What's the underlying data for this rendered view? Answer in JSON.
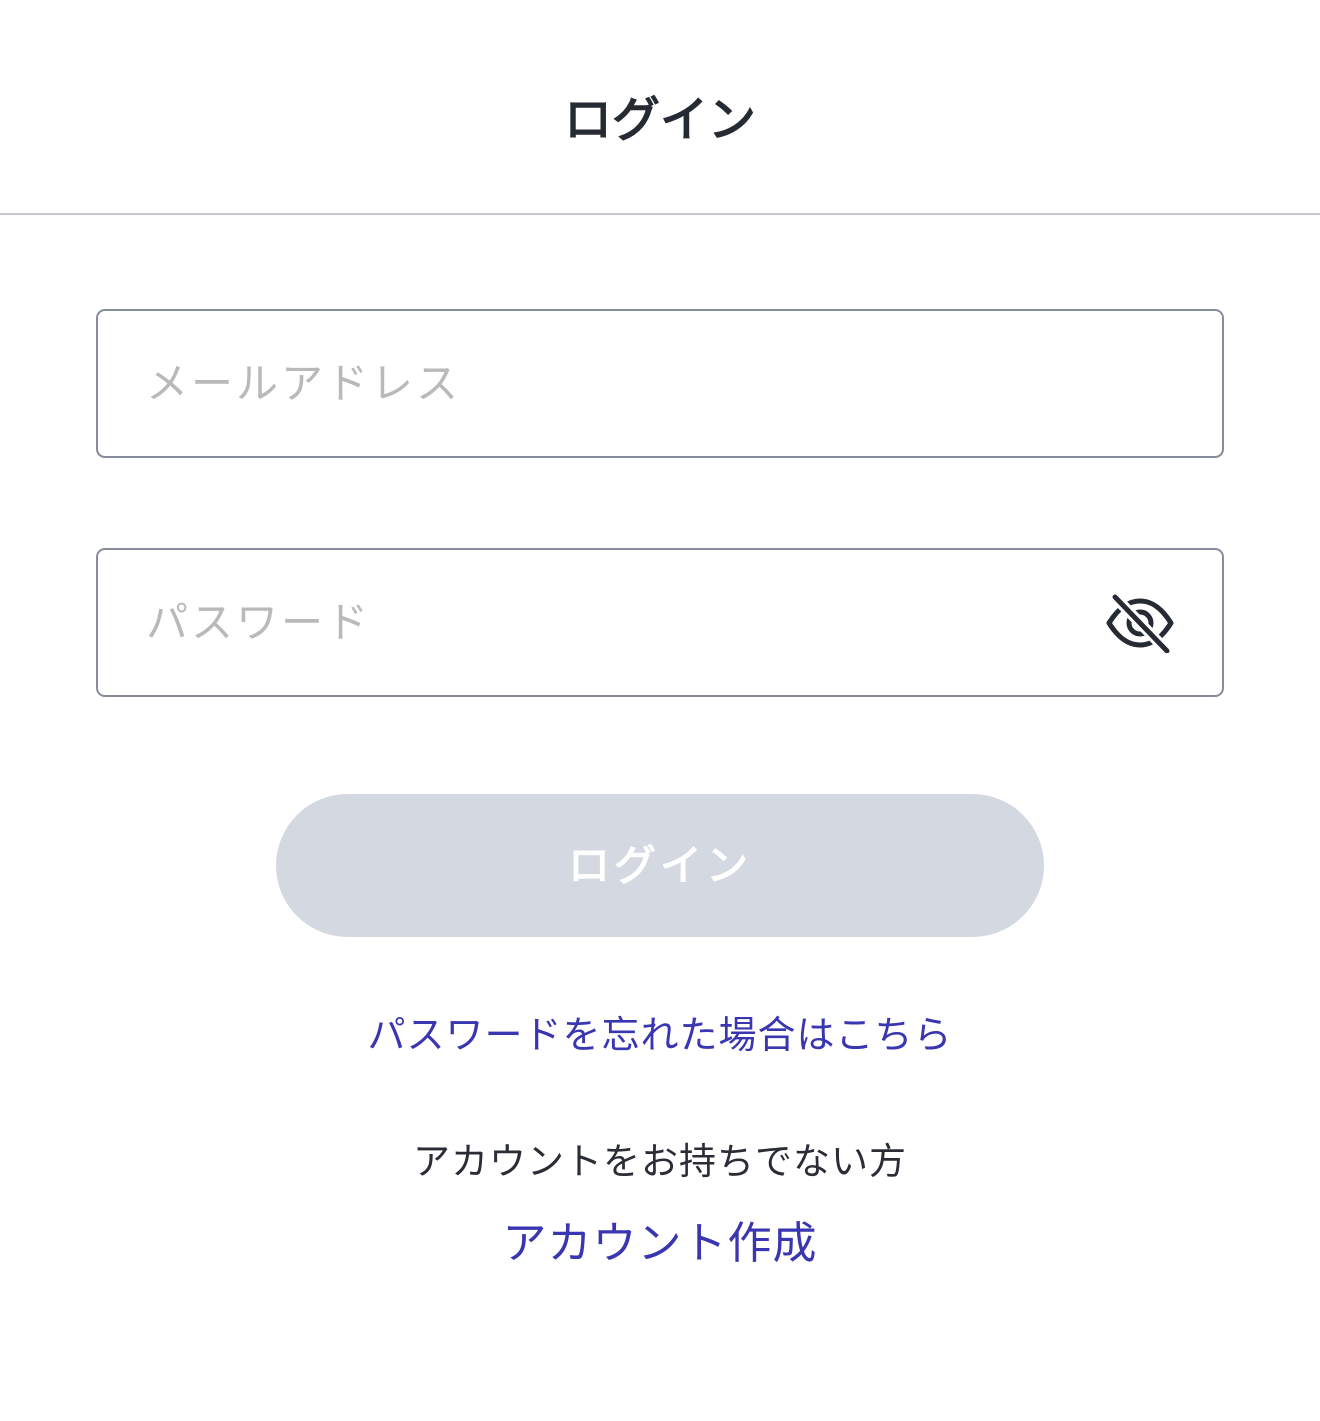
{
  "header": {
    "title": "ログイン"
  },
  "form": {
    "email": {
      "placeholder": "メールアドレス",
      "value": ""
    },
    "password": {
      "placeholder": "パスワード",
      "value": "",
      "toggle_icon": "eye-off-icon"
    },
    "submit_label": "ログイン"
  },
  "links": {
    "forgot_password": "パスワードを忘れた場合はこちら",
    "no_account_text": "アカウントをお持ちでない方",
    "create_account": "アカウント作成"
  },
  "colors": {
    "link": "#3a35b0",
    "title_text": "#262a33",
    "input_border": "#868c9c",
    "placeholder": "#b9b9b9",
    "button_disabled_bg": "#d3d8e1",
    "button_text": "#ffffff",
    "divider": "#c4c7d0"
  }
}
